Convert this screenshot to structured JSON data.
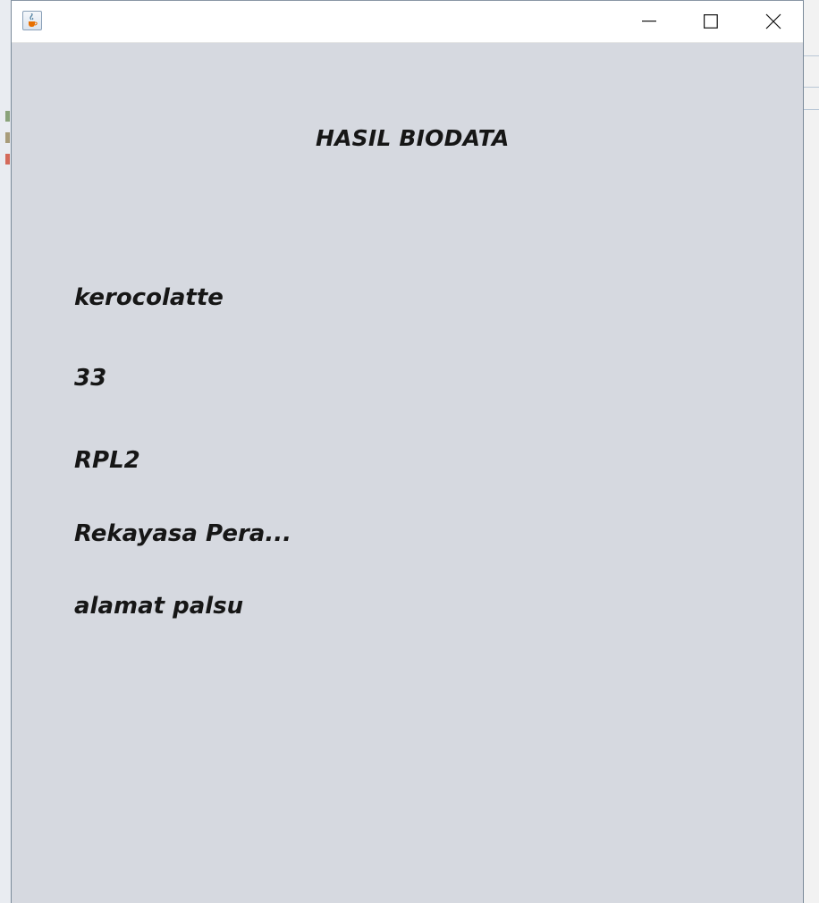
{
  "window": {
    "title": "",
    "icon": "java-cup-icon",
    "controls": [
      "minimize-icon",
      "maximize-icon",
      "close-icon"
    ]
  },
  "content": {
    "heading": "HASIL BIODATA",
    "fields": {
      "name": "kerocolatte",
      "age": "33",
      "class": "RPL2",
      "major": "Rekayasa Pera...",
      "address": "alamat palsu"
    }
  },
  "colors": {
    "content_bg": "#d6d9e0",
    "titlebar_bg": "#ffffff",
    "text": "#161616"
  }
}
